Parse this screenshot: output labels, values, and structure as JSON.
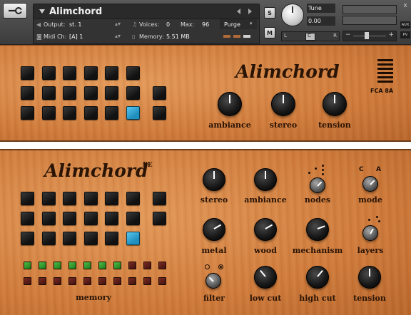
{
  "header": {
    "instrument_name": "Alimchord",
    "output_label": "Output:",
    "output_value": "st. 1",
    "midi_label": "Midi Ch:",
    "midi_value": "[A] 1",
    "voices_label": "Voices:",
    "voices_value": "0",
    "max_label": "Max:",
    "max_value": "96",
    "memory_label": "Memory:",
    "memory_value": "5.51 MB",
    "purge_label": "Purge",
    "solo_label": "S",
    "mute_label": "M",
    "tune_label": "Tune",
    "tune_value": "0.00",
    "pan_left": "L",
    "pan_right": "R",
    "pan_center": "C",
    "vol_minus": "−",
    "vol_plus": "+",
    "aux_label": "AUX",
    "pv_label": "PV",
    "close_glyph": "x"
  },
  "panel_top": {
    "logo": "Alimchord",
    "badge": "FCA 8A",
    "knobs": [
      {
        "label": "ambiance"
      },
      {
        "label": "stereo"
      },
      {
        "label": "tension"
      }
    ],
    "active_pad": "row3-col6"
  },
  "panel_bottom": {
    "logo": "Alimchord",
    "logo_suffix": "PE",
    "knobs_row1": [
      {
        "label": "stereo"
      },
      {
        "label": "ambiance"
      },
      {
        "label": "nodes"
      },
      {
        "label": "mode"
      }
    ],
    "mode_left": "C",
    "mode_right": "A",
    "knobs_row2": [
      {
        "label": "metal"
      },
      {
        "label": "wood"
      },
      {
        "label": "mechanism"
      },
      {
        "label": "layers"
      }
    ],
    "knobs_row3": [
      {
        "label": "filter"
      },
      {
        "label": "low cut"
      },
      {
        "label": "high cut"
      },
      {
        "label": "tension"
      }
    ],
    "memory_label": "memory",
    "memory_green_count": 7,
    "memory_total": 10
  },
  "colors": {
    "wood": "#d8874a",
    "pad_active": "#3fb1df",
    "memory_green": "#3fa43a",
    "memory_red": "#5a1c16",
    "label_text": "#2a1406"
  }
}
